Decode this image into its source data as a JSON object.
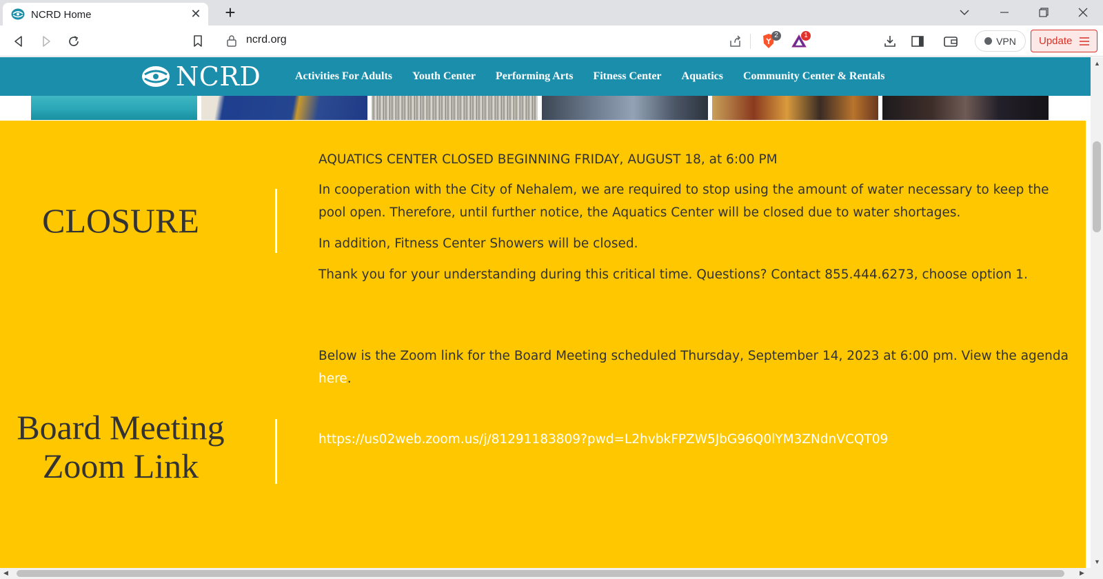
{
  "browser": {
    "tab_title": "NCRD Home",
    "url": "ncrd.org",
    "brave_badge": "2",
    "rewards_badge": "1",
    "vpn_label": "VPN",
    "update_label": "Update"
  },
  "site": {
    "logo_text": "NCRD",
    "nav": [
      "Activities For Adults",
      "Youth Center",
      "Performing Arts",
      "Fitness Center",
      "Aquatics",
      "Community Center & Rentals"
    ]
  },
  "closure": {
    "heading": "CLOSURE",
    "headline": "AQUATICS CENTER CLOSED BEGINNING FRIDAY, AUGUST 18, at 6:00 PM",
    "paragraph_1": "In cooperation with the City of Nehalem, we are required to stop using the amount of water necessary to keep the pool open. Therefore, until further notice, the Aquatics Center will be closed due to water shortages.",
    "paragraph_2": "In addition, Fitness Center Showers will be closed.",
    "paragraph_3": "Thank you for your understanding during this critical time. Questions? Contact 855.444.6273, choose option 1."
  },
  "board": {
    "heading_line_1": "Board Meeting",
    "heading_line_2": "Zoom Link",
    "intro": "Below is the Zoom link for the Board Meeting scheduled Thursday, September 14, 2023 at 6:00 pm. View the agenda ",
    "agenda_link": "here",
    "period": ".",
    "zoom_url": "https://us02web.zoom.us/j/81291183809?pwd=L2hvbkFPZW5JbG96Q0lYM3ZNdnVCQT09"
  },
  "colors": {
    "nav_teal": "#1a8eab",
    "banner_yellow": "#fec700",
    "text_dark": "#333333",
    "link_white": "#ffffff",
    "update_red": "#d93025"
  }
}
